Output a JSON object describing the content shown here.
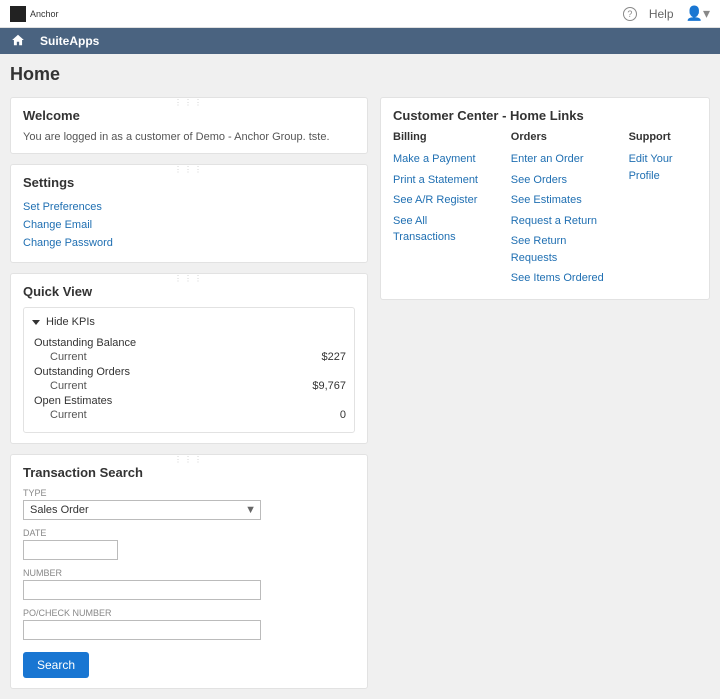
{
  "topbar": {
    "logo_text": "Anchor",
    "help_label": "Help"
  },
  "nav": {
    "app_label": "SuiteApps"
  },
  "page_title": "Home",
  "welcome": {
    "title": "Welcome",
    "message": "You are logged in as a customer of Demo - Anchor Group. tste."
  },
  "settings": {
    "title": "Settings",
    "items": [
      "Set Preferences",
      "Change Email",
      "Change Password"
    ]
  },
  "quickview": {
    "title": "Quick View",
    "toggle_label": "Hide KPIs",
    "kpis": [
      {
        "name": "Outstanding Balance",
        "period": "Current",
        "value": "$227"
      },
      {
        "name": "Outstanding Orders",
        "period": "Current",
        "value": "$9,767"
      },
      {
        "name": "Open Estimates",
        "period": "Current",
        "value": "0"
      }
    ]
  },
  "transaction_search": {
    "title": "Transaction Search",
    "fields": {
      "type_label": "TYPE",
      "type_value": "Sales Order",
      "date_label": "DATE",
      "number_label": "NUMBER",
      "po_label": "PO/CHECK NUMBER"
    },
    "search_button": "Search"
  },
  "customer_center": {
    "title": "Customer Center - Home Links",
    "columns": [
      {
        "header": "Billing",
        "links": [
          "Make a Payment",
          "Print a Statement",
          "See A/R Register",
          "See All Transactions"
        ]
      },
      {
        "header": "Orders",
        "links": [
          "Enter an Order",
          "See Orders",
          "See Estimates",
          "Request a Return",
          "See Return Requests",
          "See Items Ordered"
        ]
      },
      {
        "header": "Support",
        "links": [
          "Edit Your Profile"
        ]
      }
    ]
  }
}
